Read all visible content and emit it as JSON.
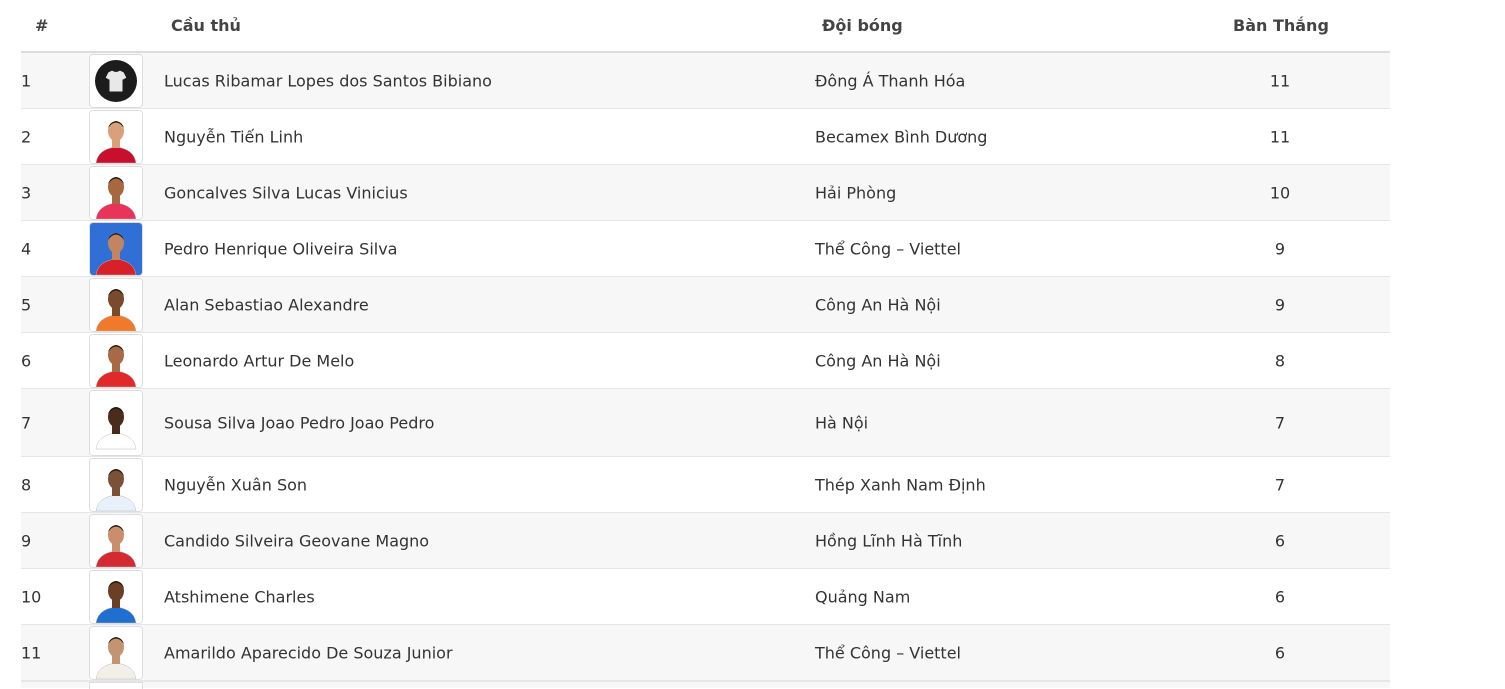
{
  "table": {
    "headers": {
      "rank": "#",
      "player": "Cầu thủ",
      "team": "Đội bóng",
      "goals": "Bàn Thắng"
    },
    "rows": [
      {
        "rank": "1",
        "name": "Lucas Ribamar Lopes dos Santos Bibiano",
        "team": "Đông Á Thanh Hóa",
        "goals": "11",
        "avatar": "jersey-icon",
        "kit": "#ffffff"
      },
      {
        "rank": "2",
        "name": "Nguyễn Tiến Linh",
        "team": "Becamex Bình Dương",
        "goals": "11",
        "avatar": "player-photo",
        "kit": "#c8102e"
      },
      {
        "rank": "3",
        "name": "Goncalves Silva Lucas Vinicius",
        "team": "Hải Phòng",
        "goals": "10",
        "avatar": "player-photo",
        "kit": "#e8335a"
      },
      {
        "rank": "4",
        "name": "Pedro Henrique Oliveira Silva",
        "team": "Thể Công – Viettel",
        "goals": "9",
        "avatar": "player-photo",
        "kit": "#d8202a"
      },
      {
        "rank": "5",
        "name": "Alan Sebastiao Alexandre",
        "team": "Công An Hà Nội",
        "goals": "9",
        "avatar": "player-photo",
        "kit": "#f07a2a"
      },
      {
        "rank": "6",
        "name": "Leonardo Artur De Melo",
        "team": "Công An Hà Nội",
        "goals": "8",
        "avatar": "player-photo",
        "kit": "#e02a2a"
      },
      {
        "rank": "7",
        "name": "Sousa Silva Joao Pedro Joao Pedro",
        "team": "Hà Nội",
        "goals": "7",
        "avatar": "player-photo",
        "kit": "#ffffff"
      },
      {
        "rank": "8",
        "name": "Nguyễn Xuân Son",
        "team": "Thép Xanh Nam Định",
        "goals": "7",
        "avatar": "player-photo",
        "kit": "#e8f0fa"
      },
      {
        "rank": "9",
        "name": "Candido Silveira Geovane Magno",
        "team": "Hồng Lĩnh Hà Tĩnh",
        "goals": "6",
        "avatar": "player-photo",
        "kit": "#d42a32"
      },
      {
        "rank": "10",
        "name": "Atshimene Charles",
        "team": "Quảng Nam",
        "goals": "6",
        "avatar": "player-photo",
        "kit": "#1f6fd1"
      },
      {
        "rank": "11",
        "name": "Amarildo Aparecido De Souza Junior",
        "team": "Thể Công – Viettel",
        "goals": "6",
        "avatar": "player-photo",
        "kit": "#f2efe8"
      }
    ]
  }
}
